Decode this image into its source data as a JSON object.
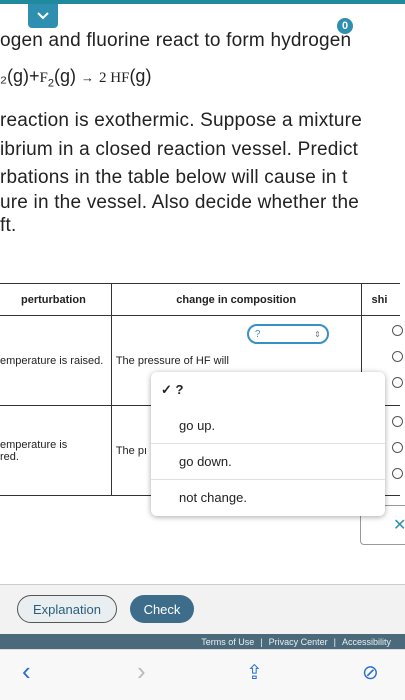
{
  "header": {
    "badge_count": "0"
  },
  "question": {
    "line1": "ogen and fluorine react to form hydrogen",
    "equation": {
      "left": "₂(g)+",
      "left_species": "F",
      "left_sub": "2",
      "left_phase": "(g)",
      "arrow": "→",
      "product": "2 HF",
      "product_phase": "(g)"
    },
    "line3": "reaction is exothermic. Suppose a mixture",
    "line4": "ibrium in a closed reaction vessel. Predict",
    "line5": "rbations in the table below will cause in t",
    "line6": "ure in the vessel. Also decide whether the",
    "line7": "ft."
  },
  "table": {
    "headers": {
      "perturbation": "perturbation",
      "change": "change in composition",
      "shift": "shi"
    },
    "rows": [
      {
        "perturbation": "emperature is raised.",
        "change_prefix": "The pressure of HF will",
        "select_value": "?"
      },
      {
        "perturbation": "emperature is\nred.",
        "change_prefix": "The pı"
      }
    ]
  },
  "dropdown": {
    "selected": "✓ ?",
    "options": [
      "go up.",
      "go down.",
      "not change."
    ]
  },
  "x_button": {
    "label": "✕"
  },
  "footer": {
    "explanation_label": "Explanation",
    "check_label": "Check",
    "terms": "Terms of Use",
    "privacy": "Privacy Center",
    "accessibility": "Accessibility",
    "sep": "|"
  },
  "browser": {
    "back": "‹",
    "forward": "›",
    "share": "⇪",
    "compass": "⊘"
  },
  "colors": {
    "accent": "#2f8fb0",
    "check_bg": "#3d6d8a",
    "legal_bg": "#4a6a7b"
  }
}
